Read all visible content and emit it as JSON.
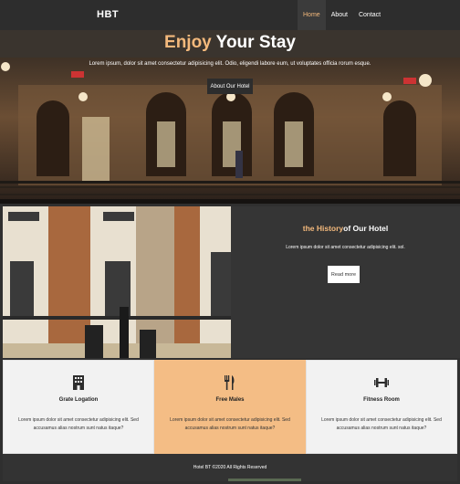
{
  "nav": {
    "brand": "HBT",
    "links": [
      {
        "label": "Home",
        "active": true
      },
      {
        "label": "About",
        "active": false
      },
      {
        "label": "Contact",
        "active": false
      }
    ]
  },
  "hero": {
    "title_accent": "Enjoy",
    "title_rest": " Your Stay",
    "subtitle": "Lorem ipsum, dolor sit amet consectetur adipisicing elit. Odio, eligendi labore eum, ut voluptates officia rorum esque.",
    "button": "About Our Hotel"
  },
  "history": {
    "title_accent": "the History",
    "title_rest": "of Our Hotel",
    "text": "Lorem ipsum dolor sit amet consectetur adipisicing elit. sol.",
    "button": "Read more"
  },
  "features": [
    {
      "icon": "building-icon",
      "title": "Grate Logation",
      "text": "Lorem ipsum dolor sit amet consectetur adipisicing elit. Sed accusamus alias nostrum sunt natus itaque?"
    },
    {
      "icon": "fork-knife-icon",
      "title": "Free Males",
      "text": "Lorem ipsum dolor sit amet consectetur adipisicing elit. Sed accusamus alias nostrum sunt natus itaque?"
    },
    {
      "icon": "dumbbell-icon",
      "title": "Fitness Room",
      "text": "Lorem ipsum dolor sit amet consectetur adipisicing elit. Sed accusamus alias nostrum sunt natus itaque?"
    }
  ],
  "footer": {
    "text": "Hotel BT ©2020 All Rights Reserved"
  },
  "colors": {
    "accent": "#f4b97c",
    "dark": "#2d2d2d",
    "highlight": "#f4bd85"
  }
}
